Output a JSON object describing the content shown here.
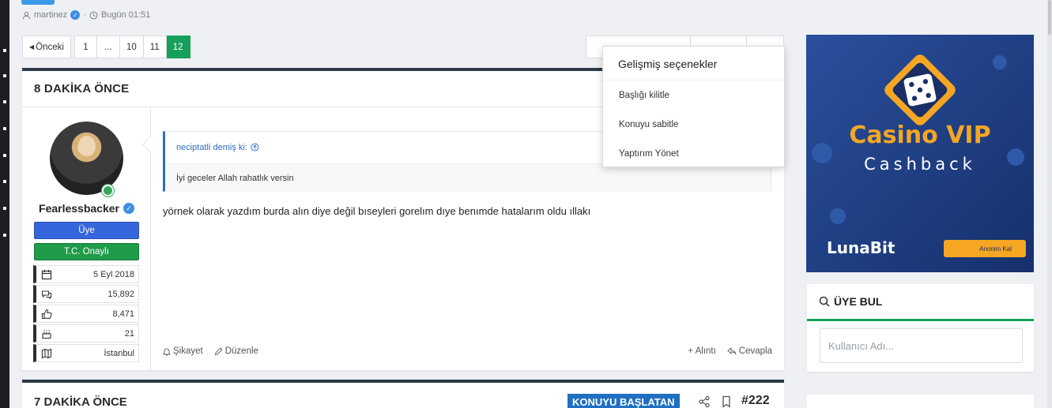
{
  "thread": {
    "author": "martinez",
    "time": "Bugün 01:51"
  },
  "pagination": {
    "prev_label": "Önceki",
    "pages": [
      "1",
      "...",
      "10",
      "11",
      "12"
    ],
    "active": "12"
  },
  "post": {
    "when": "8 DAKİKA ÖNCE",
    "user": {
      "name": "Fearlessbacker",
      "role": "Üye",
      "badge": "T.C. Onaylı",
      "stats": [
        {
          "icon": "calendar-icon",
          "value": "5 Eyl 2018"
        },
        {
          "icon": "messages-icon",
          "value": "15,892"
        },
        {
          "icon": "thumbs-up-icon",
          "value": "8,471"
        },
        {
          "icon": "cake-icon",
          "value": "21"
        },
        {
          "icon": "map-icon",
          "value": "İstanbul"
        }
      ]
    },
    "quote": {
      "author_line": "neciptatli demiş ki:",
      "text": "İyi geceler Allah rahatlık versin"
    },
    "message": "yörnek olarak yazdım burda alın diye değil bıseyleri gorelım dıye benımde hatalarım oldu ıllakı",
    "actions_left": [
      "Şikayet",
      "Düzenle"
    ],
    "actions_right": [
      "+ Alıntı",
      "Cevapla"
    ]
  },
  "dropdown": {
    "title": "Gelişmiş seçenekler",
    "items": [
      "Başlığı kilitle",
      "Konuyu sabitle",
      "Yaptırım Yönet"
    ]
  },
  "next_post": {
    "when": "7 DAKİKA ÖNCE",
    "starter_label": "KONUYU BAŞLATAN",
    "number": "#222"
  },
  "ad": {
    "line1": "Casino VIP",
    "line2": "Cashback",
    "brand": "LunaBit",
    "tag": "Anonim Kal"
  },
  "find_member": {
    "title": "ÜYE BUL",
    "placeholder": "Kullanıcı Adı..."
  },
  "colors": {
    "accent_green": "#17a05a",
    "role_blue": "#3566dc",
    "starter_blue": "#1f6fc2",
    "ad_orange": "#f5a623"
  }
}
